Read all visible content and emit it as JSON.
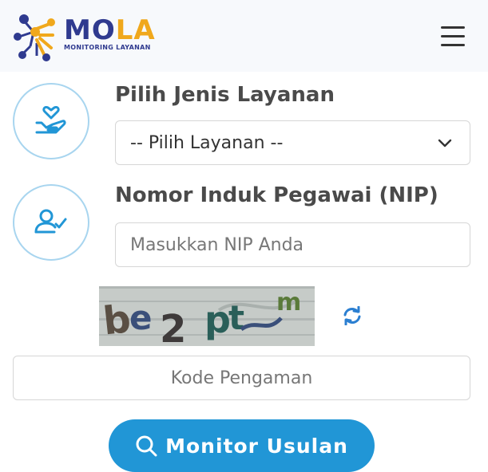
{
  "header": {
    "logo_main_left": "MO",
    "logo_main_right": "LA",
    "logo_subtitle": "MONITORING LAYANAN",
    "menu_icon": "hamburger-icon"
  },
  "form": {
    "service": {
      "label": "Pilih Jenis Layanan",
      "selected": "-- Pilih Layanan --",
      "icon": "hand-heart-icon"
    },
    "nip": {
      "label": "Nomor Induk Pegawai (NIP)",
      "placeholder": "Masukkan NIP Anda",
      "icon": "user-check-icon"
    },
    "captcha": {
      "image_text": "be2pt m",
      "refresh_icon": "refresh-icon",
      "placeholder": "Kode Pengaman"
    },
    "submit": {
      "label": "Monitor Usulan",
      "icon": "search-icon"
    }
  },
  "colors": {
    "primary": "#2196d6",
    "icon_ring": "#a8d5ef",
    "logo_blue": "#2f3a8f",
    "logo_orange": "#f0a81c"
  }
}
